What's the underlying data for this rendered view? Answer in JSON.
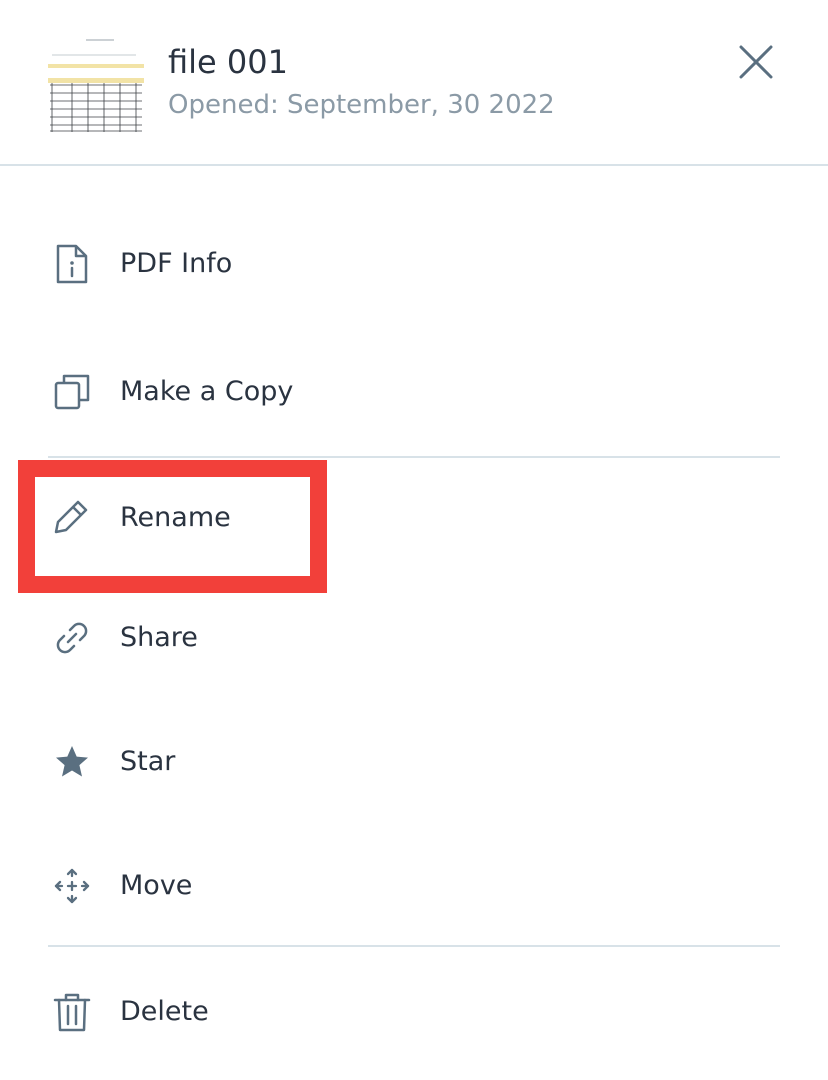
{
  "header": {
    "title": "file 001",
    "subtitle": "Opened: September, 30 2022",
    "close_icon": "close-icon"
  },
  "menu": {
    "items": [
      {
        "id": "pdf-info",
        "label": "PDF Info",
        "icon": "file-info-icon"
      },
      {
        "id": "make-copy",
        "label": "Make a Copy",
        "icon": "copy-icon"
      },
      {
        "id": "rename",
        "label": "Rename",
        "icon": "pencil-icon"
      },
      {
        "id": "share",
        "label": "Share",
        "icon": "link-icon"
      },
      {
        "id": "star",
        "label": "Star",
        "icon": "star-icon"
      },
      {
        "id": "move",
        "label": "Move",
        "icon": "move-arrows-icon"
      },
      {
        "id": "delete",
        "label": "Delete",
        "icon": "trash-icon"
      }
    ]
  },
  "colors": {
    "text": "#2a3340",
    "subtext": "#8b9aa6",
    "icon": "#5a6f80",
    "divider": "#d8e2e8",
    "highlight": "#f2403a"
  }
}
